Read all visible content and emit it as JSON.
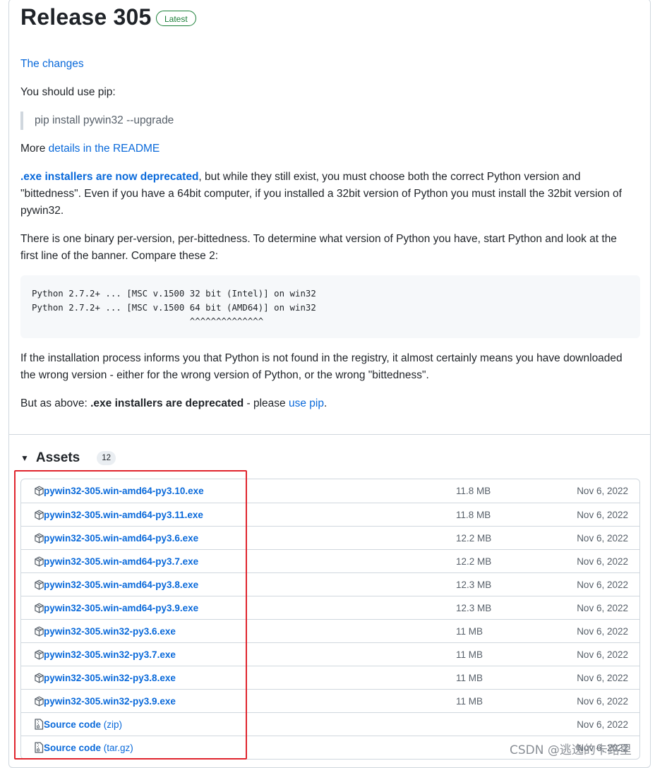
{
  "release": {
    "title": "Release 305",
    "latest_label": "Latest"
  },
  "body": {
    "changes_link": "The changes",
    "pip_intro": "You should use pip:",
    "pip_command": "pip install pywin32 --upgrade",
    "more_prefix": "More ",
    "more_link": "details in the README",
    "deprecated_link": ".exe installers are now deprecated",
    "deprecated_rest": ", but while they still exist, you must choose both the correct Python version and \"bittedness\". Even if you have a 64bit computer, if you installed a 32bit version of Python you must install the 32bit version of pywin32.",
    "binary_text": "There is one binary per-version, per-bittedness. To determine what version of Python you have, start Python and look at the first line of the banner. Compare these 2:",
    "code_block": "Python 2.7.2+ ... [MSC v.1500 32 bit (Intel)] on win32\nPython 2.7.2+ ... [MSC v.1500 64 bit (AMD64)] on win32\n                              ^^^^^^^^^^^^^^",
    "registry_text": "If the installation process informs you that Python is not found in the registry, it almost certainly means you have downloaded the wrong version - either for the wrong version of Python, or the wrong \"bittedness\".",
    "above_prefix": "But as above: ",
    "above_strong": ".exe installers are deprecated",
    "above_mid": " - please ",
    "above_link": "use pip",
    "above_end": "."
  },
  "assets": {
    "title": "Assets",
    "count": "12",
    "items": [
      {
        "name": "pywin32-305.win-amd64-py3.10.exe",
        "suffix": "",
        "size": "11.8 MB",
        "date": "Nov 6, 2022",
        "icon": "package-icon"
      },
      {
        "name": "pywin32-305.win-amd64-py3.11.exe",
        "suffix": "",
        "size": "11.8 MB",
        "date": "Nov 6, 2022",
        "icon": "package-icon"
      },
      {
        "name": "pywin32-305.win-amd64-py3.6.exe",
        "suffix": "",
        "size": "12.2 MB",
        "date": "Nov 6, 2022",
        "icon": "package-icon"
      },
      {
        "name": "pywin32-305.win-amd64-py3.7.exe",
        "suffix": "",
        "size": "12.2 MB",
        "date": "Nov 6, 2022",
        "icon": "package-icon"
      },
      {
        "name": "pywin32-305.win-amd64-py3.8.exe",
        "suffix": "",
        "size": "12.3 MB",
        "date": "Nov 6, 2022",
        "icon": "package-icon"
      },
      {
        "name": "pywin32-305.win-amd64-py3.9.exe",
        "suffix": "",
        "size": "12.3 MB",
        "date": "Nov 6, 2022",
        "icon": "package-icon"
      },
      {
        "name": "pywin32-305.win32-py3.6.exe",
        "suffix": "",
        "size": "11 MB",
        "date": "Nov 6, 2022",
        "icon": "package-icon"
      },
      {
        "name": "pywin32-305.win32-py3.7.exe",
        "suffix": "",
        "size": "11 MB",
        "date": "Nov 6, 2022",
        "icon": "package-icon"
      },
      {
        "name": "pywin32-305.win32-py3.8.exe",
        "suffix": "",
        "size": "11 MB",
        "date": "Nov 6, 2022",
        "icon": "package-icon"
      },
      {
        "name": "pywin32-305.win32-py3.9.exe",
        "suffix": "",
        "size": "11 MB",
        "date": "Nov 6, 2022",
        "icon": "package-icon"
      },
      {
        "name": "Source code",
        "suffix": " (zip)",
        "size": "",
        "date": "Nov 6, 2022",
        "icon": "file-zip-icon"
      },
      {
        "name": "Source code",
        "suffix": " (tar.gz)",
        "size": "",
        "date": "Nov 6, 2022",
        "icon": "file-zip-icon"
      }
    ]
  },
  "watermark": "CSDN @逃逸的卡路里",
  "colors": {
    "link": "#0969da",
    "latest": "#1a7f37",
    "highlight": "#e0242d"
  }
}
